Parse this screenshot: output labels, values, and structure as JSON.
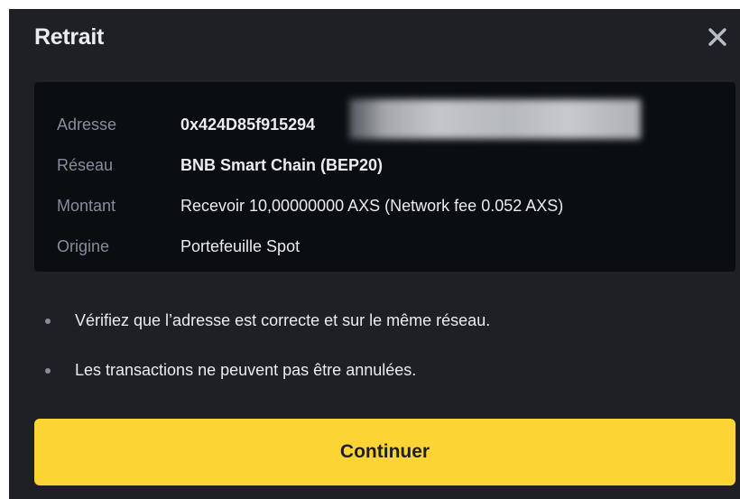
{
  "modal": {
    "title": "Retrait",
    "close_icon": "close-icon"
  },
  "details": {
    "rows": [
      {
        "label": "Adresse",
        "value": "0x424D85f915294"
      },
      {
        "label": "Réseau",
        "value": "BNB Smart Chain (BEP20)"
      },
      {
        "label": "Montant",
        "value": "Recevoir 10,00000000 AXS (Network fee 0.052 AXS)"
      },
      {
        "label": "Origine",
        "value": "Portefeuille Spot"
      }
    ]
  },
  "notices": [
    "Vérifiez que l’adresse est correcte et sur le même réseau.",
    "Les transactions ne peuvent pas être annulées."
  ],
  "actions": {
    "continue_label": "Continuer"
  },
  "colors": {
    "background": "#1e2026",
    "panel": "#0b0e11",
    "label": "#848e9c",
    "text": "#eaecef",
    "accent": "#fcd535"
  }
}
